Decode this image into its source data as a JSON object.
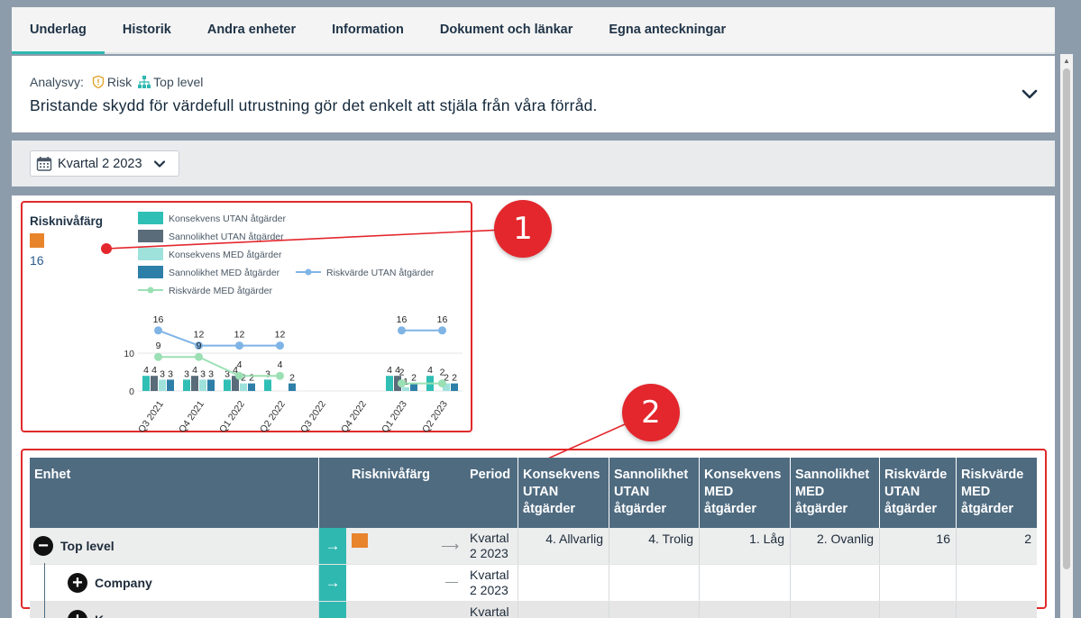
{
  "tabs": [
    {
      "label": "Underlag",
      "active": true
    },
    {
      "label": "Historik"
    },
    {
      "label": "Andra enheter"
    },
    {
      "label": "Information"
    },
    {
      "label": "Dokument och länkar"
    },
    {
      "label": "Egna anteckningar"
    }
  ],
  "analysis": {
    "prefix": "Analysvy:",
    "risk_label": "Risk",
    "level_label": "Top level",
    "title": "Bristande skydd för värdefull utrustning gör det enkelt att stjäla från våra förråd."
  },
  "filter": {
    "period": "Kvartal 2 2023"
  },
  "risklevel": {
    "title": "Risknivåfärg",
    "color": "#e8842c",
    "value": "16"
  },
  "callouts": {
    "one": "1",
    "two": "2"
  },
  "chart_data": {
    "type": "bar",
    "categories": [
      "Q3 2021",
      "Q4 2021",
      "Q1 2022",
      "Q2 2022",
      "Q3 2022",
      "Q4 2022",
      "Q1 2023",
      "Q2 2023"
    ],
    "yticks": [
      "0",
      "10"
    ],
    "ylim": [
      0,
      20
    ],
    "legend_position": "top",
    "series": [
      {
        "name": "Konsekvens UTAN åtgärder",
        "kind": "bar",
        "color": "#2fbfb5",
        "values": [
          4,
          3,
          3,
          3,
          null,
          null,
          4,
          4
        ]
      },
      {
        "name": "Sannolikhet UTAN åtgärder",
        "kind": "bar",
        "color": "#5a6b7a",
        "values": [
          4,
          4,
          4,
          null,
          null,
          null,
          4,
          null
        ]
      },
      {
        "name": "Konsekvens MED åtgärder",
        "kind": "bar",
        "color": "#9fe2dc",
        "values": [
          3,
          3,
          2,
          null,
          null,
          null,
          1,
          2
        ]
      },
      {
        "name": "Sannolikhet MED åtgärder",
        "kind": "bar",
        "color": "#2e7fa8",
        "values": [
          3,
          3,
          2,
          2,
          null,
          null,
          2,
          2
        ]
      },
      {
        "name": "Riskvärde UTAN åtgärder",
        "kind": "line",
        "color": "#7fb4e5",
        "values": [
          16,
          12,
          12,
          12,
          null,
          null,
          16,
          16
        ]
      },
      {
        "name": "Riskvärde MED åtgärder",
        "kind": "line",
        "color": "#9be0b4",
        "values": [
          9,
          9,
          4,
          4,
          null,
          null,
          2,
          2
        ]
      }
    ]
  },
  "table": {
    "headers": {
      "enhet": "Enhet",
      "risknivafarg": "Risknivåfärg",
      "period": "Period",
      "konsekvens_utan": "Konsekvens UTAN åtgärder",
      "sannolikhet_utan": "Sannolikhet UTAN åtgärder",
      "konsekvens_med": "Konsekvens MED åtgärder",
      "sannolikhet_med": "Sannolikhet MED åtgärder",
      "riskvarde_utan": "Riskvärde UTAN åtgärder",
      "riskvarde_med": "Riskvärde MED åtgärder"
    },
    "rows": [
      {
        "unit": "Top level",
        "expand": "−",
        "arrow": "→",
        "trend": "⟶",
        "period": "Kvartal 2 2023",
        "k_utan": "4. Allvarlig",
        "s_utan": "4. Trolig",
        "k_med": "1. Låg",
        "s_med": "2. Ovanlig",
        "rv_utan": "16",
        "rv_med": "2"
      },
      {
        "unit": "Company",
        "expand": "+",
        "arrow": "→",
        "trend": "—",
        "period": "Kvartal 2 2023",
        "k_utan": "",
        "s_utan": "",
        "k_med": "",
        "s_med": "",
        "rv_utan": "",
        "rv_med": ""
      },
      {
        "unit": "K",
        "expand": "+",
        "arrow": "→",
        "trend": "—",
        "period": "Kvartal",
        "k_utan": "",
        "s_utan": "",
        "k_med": "",
        "s_med": "",
        "rv_utan": "",
        "rv_med": ""
      }
    ]
  }
}
